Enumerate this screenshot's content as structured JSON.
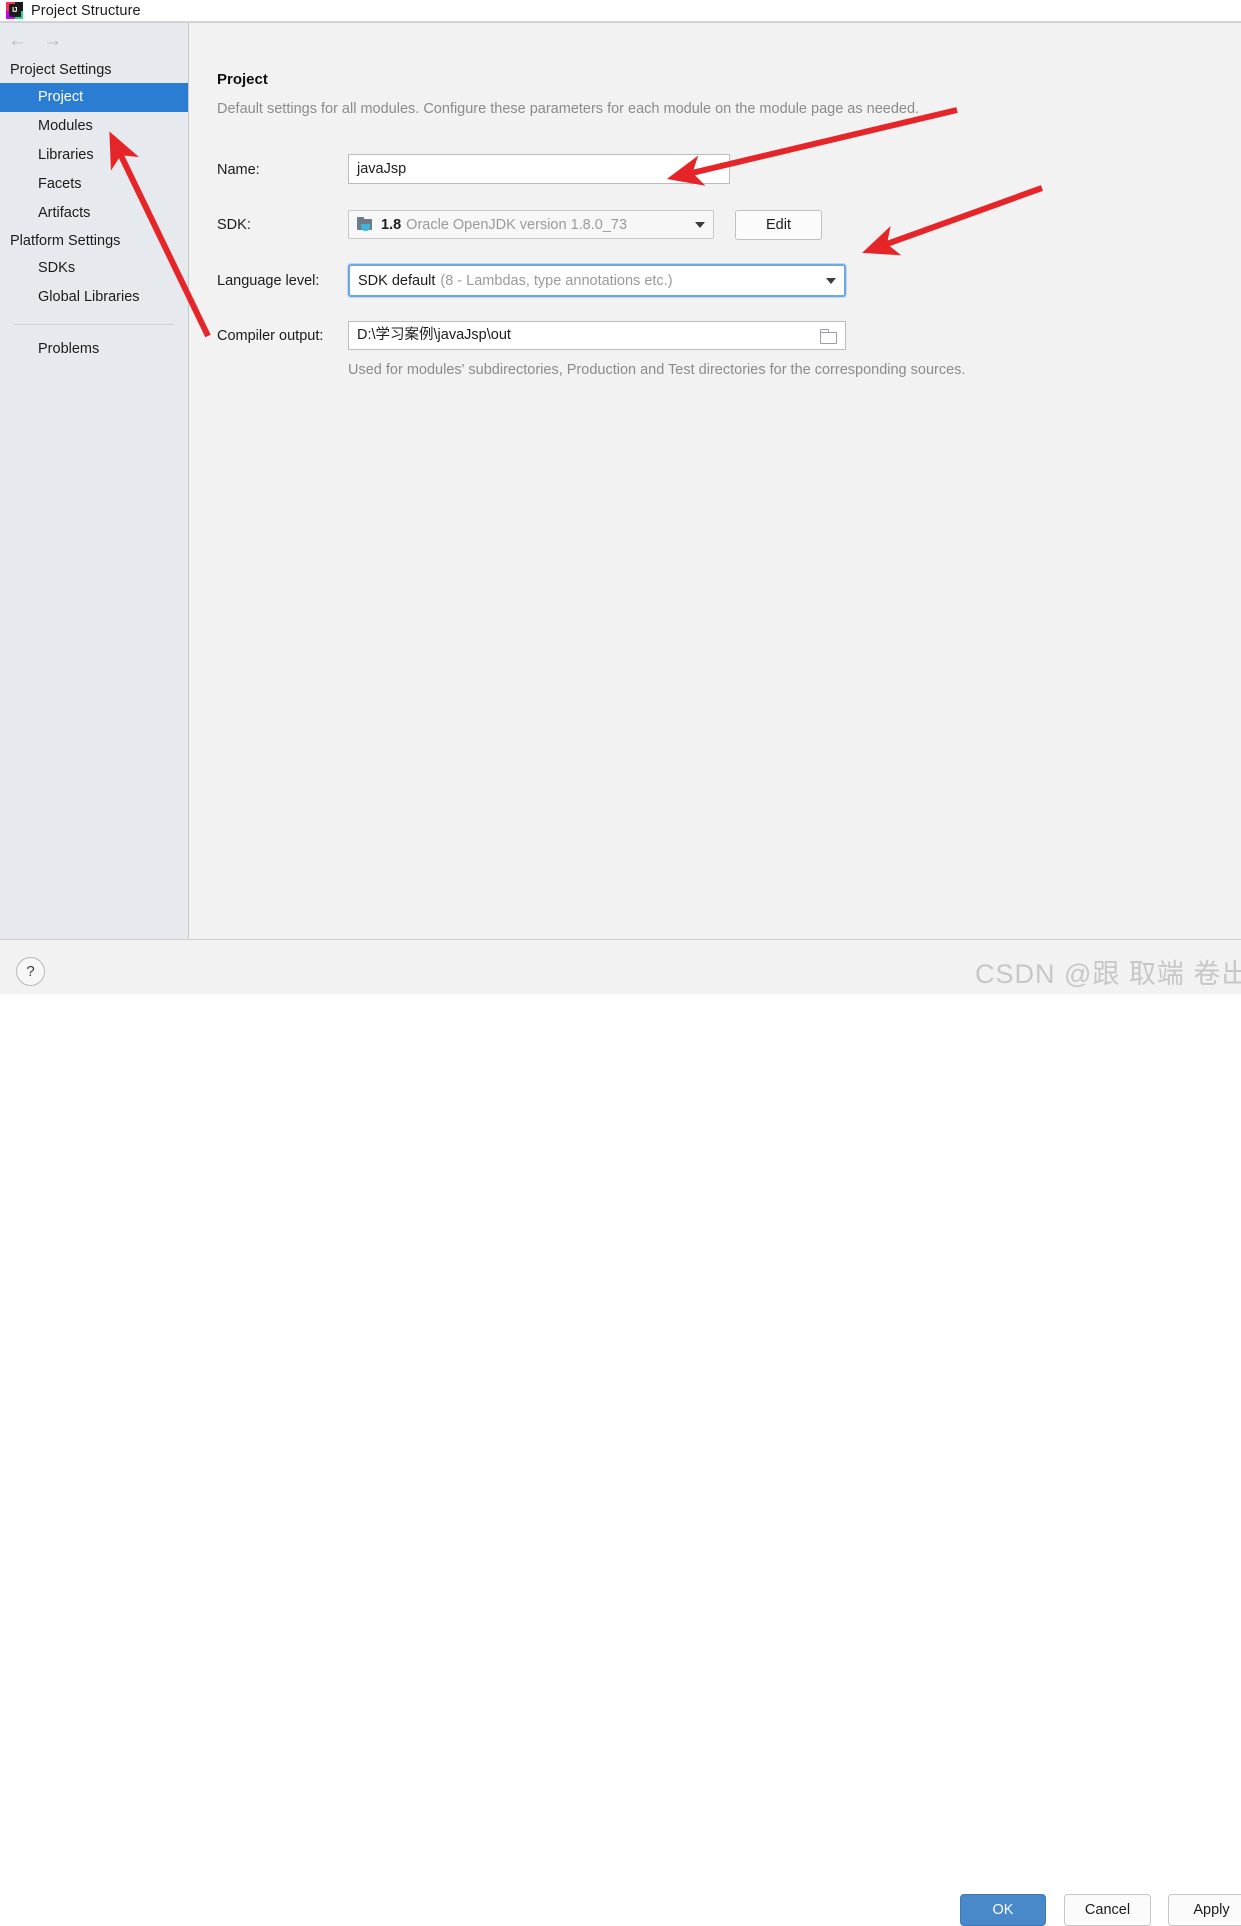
{
  "window": {
    "title": "Project Structure",
    "logo_text": "IJ"
  },
  "nav": {
    "back_icon": "←",
    "forward_icon": "→"
  },
  "sidebar": {
    "groups": [
      {
        "label": "Project Settings",
        "items": [
          {
            "label": "Project",
            "selected": true
          },
          {
            "label": "Modules",
            "selected": false
          },
          {
            "label": "Libraries",
            "selected": false
          },
          {
            "label": "Facets",
            "selected": false
          },
          {
            "label": "Artifacts",
            "selected": false
          }
        ]
      },
      {
        "label": "Platform Settings",
        "items": [
          {
            "label": "SDKs",
            "selected": false
          },
          {
            "label": "Global Libraries",
            "selected": false
          }
        ]
      }
    ],
    "problems_label": "Problems"
  },
  "main": {
    "heading": "Project",
    "description": "Default settings for all modules. Configure these parameters for each module on the module page as needed.",
    "fields": {
      "name": {
        "label": "Name:",
        "value": "javaJsp"
      },
      "sdk": {
        "label": "SDK:",
        "value_strong": "1.8",
        "value_dim": "Oracle OpenJDK version 1.8.0_73",
        "edit_button": "Edit"
      },
      "language_level": {
        "label": "Language level:",
        "value_strong": "SDK default",
        "value_dim": "(8 - Lambdas, type annotations etc.)"
      },
      "compiler_output": {
        "label": "Compiler output:",
        "value": "D:\\学习案例\\javaJsp\\out",
        "hint": "Used for modules' subdirectories, Production and Test directories for the corresponding sources."
      }
    }
  },
  "bottom": {
    "help_label": "?",
    "ok_label": "OK",
    "cancel_label": "Cancel",
    "apply_label": "Apply"
  },
  "watermark": {
    "text": "CSDN @跟 取端 卷出 一 片天"
  },
  "colors": {
    "selection_blue": "#2b7cd3",
    "primary_button": "#4989c9",
    "annotation_red": "#e52528",
    "sidebar_bg": "#e6eaee",
    "panel_bg": "#f2f2f2"
  },
  "annotations": [
    {
      "name": "arrow-to-sdk"
    },
    {
      "name": "arrow-to-language-level"
    },
    {
      "name": "arrow-to-modules"
    }
  ]
}
